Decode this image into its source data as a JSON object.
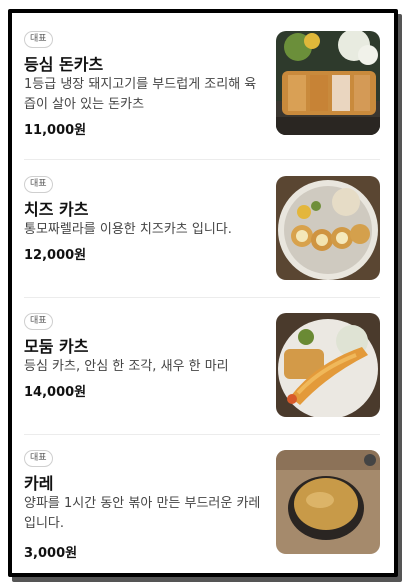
{
  "menu": {
    "items": [
      {
        "badge": "대표",
        "name": "등심 돈카츠",
        "description": "1등급 냉장 돼지고기를 부드럽게 조리해 육즙이 살아 있는 돈카츠",
        "price": "11,000원",
        "image_icon": "pork-cutlet-photo"
      },
      {
        "badge": "대표",
        "name": "치즈 카츠",
        "description": "통모짜렐라를 이용한 치즈카츠 입니다.",
        "price": "12,000원",
        "image_icon": "cheese-cutlet-photo"
      },
      {
        "badge": "대표",
        "name": "모둠 카츠",
        "description": "등심 카츠, 안심 한 조각, 새우 한 마리",
        "price": "14,000원",
        "image_icon": "mixed-cutlet-photo"
      },
      {
        "badge": "대표",
        "name": "카레",
        "description": "양파를 1시간 동안 볶아 만든 부드러운 카레입니다.",
        "price": "3,000원",
        "image_icon": "curry-bowl-photo"
      }
    ]
  }
}
